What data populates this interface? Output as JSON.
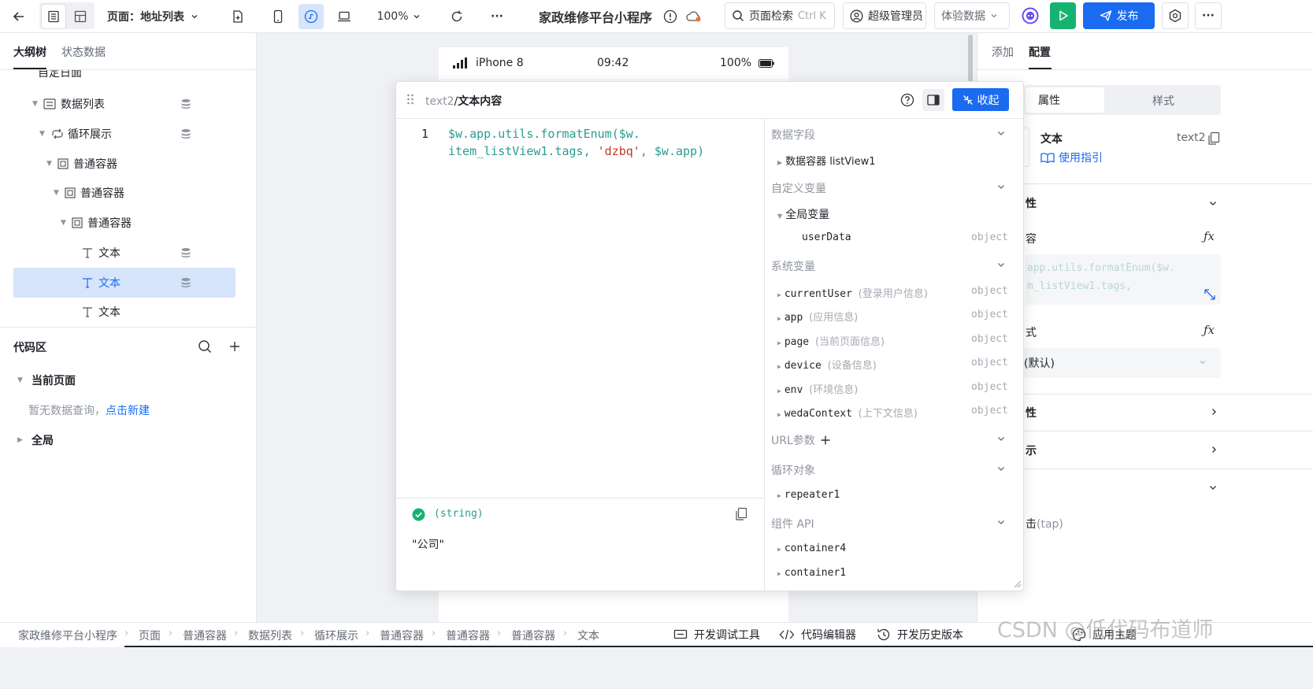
{
  "toolbar": {
    "page_label": "页面：地址列表",
    "zoom": "100%",
    "more": "···",
    "app_title": "家政维修平台小程序",
    "search_placeholder": "页面检索",
    "search_shortcut": "Ctrl K",
    "user": "超级管理员",
    "data_mode": "体验数据",
    "publish": "发布"
  },
  "left": {
    "tabs": [
      "大纲树",
      "状态数据"
    ],
    "partial_item": "自定日面",
    "tree": [
      {
        "label": "数据列表"
      },
      {
        "label": "循环展示"
      },
      {
        "label": "普通容器"
      },
      {
        "label": "普通容器"
      },
      {
        "label": "普通容器"
      },
      {
        "label": "文本"
      },
      {
        "label": "文本"
      },
      {
        "label": "文本"
      }
    ],
    "code": {
      "title": "代码区",
      "current_page": "当前页面",
      "empty_text": "暂无数据查询，",
      "create_link": "点击新建",
      "global": "全局"
    }
  },
  "phone": {
    "carrier": "iPhone 8",
    "time": "09:42",
    "battery": "100%"
  },
  "popup": {
    "breadcrumb_link": "text2",
    "breadcrumb_sep": "/",
    "breadcrumb_current": "文本内容",
    "collapse": "收起",
    "code": {
      "line_no": "1",
      "line1": "$w.app.utils.formatEnum($w.",
      "line2_a": "item_listView1.tags, ",
      "line2_str": "'dzbq'",
      "line2_b": ", $w.app)"
    },
    "result_type": "(string)",
    "result_value": "\"公司\"",
    "vars": {
      "data_fields": "数据字段",
      "data_container": "数据容器 listView1",
      "custom_vars": "自定义变量",
      "global_vars": "全局变量",
      "user_data": "userData",
      "user_data_type": "object",
      "system_vars": "系统变量",
      "system_items": [
        {
          "name": "currentUser",
          "desc": "(登录用户信息)",
          "type": "object"
        },
        {
          "name": "app",
          "desc": "(应用信息)",
          "type": "object"
        },
        {
          "name": "page",
          "desc": "(当前页面信息)",
          "type": "object"
        },
        {
          "name": "device",
          "desc": "(设备信息)",
          "type": "object"
        },
        {
          "name": "env",
          "desc": "(环境信息)",
          "type": "object"
        },
        {
          "name": "wedaContext",
          "desc": "(上下文信息)",
          "type": "object"
        }
      ],
      "url_params": "URL参数",
      "loop_obj": "循环对象",
      "repeater": "repeater1",
      "component_api": "组件 API",
      "containers": [
        "container4",
        "container1"
      ]
    }
  },
  "right": {
    "tabs": [
      "添加",
      "配置"
    ],
    "subtabs": [
      "属性",
      "样式"
    ],
    "component_name": "文本",
    "component_id": "text2",
    "guide": "使用指引",
    "sec1": "性",
    "content_label": "容",
    "content_code_1": "app.utils.formatEnum($w.",
    "content_code_2": "m_listView1.tags,",
    "format_label": "式",
    "format_value": "(默认)",
    "sec2": "性",
    "sec3": "示",
    "event": "击",
    "event_tap": "(tap)"
  },
  "status": {
    "crumbs": [
      "家政维修平台小程序",
      "页面",
      "普通容器",
      "数据列表",
      "循环展示",
      "普通容器",
      "普通容器",
      "普通容器",
      "文本"
    ],
    "tools": [
      "开发调试工具",
      "代码编辑器",
      "开发历史版本"
    ],
    "theme": "应用主题",
    "watermark": "CSDN @低代码布道师"
  },
  "colors": {
    "primary": "#1a6bf0",
    "selected_bg": "#d6e4fc",
    "run_green": "#15b371",
    "code_green": "#2a9d8f",
    "code_string": "#c0392b"
  }
}
